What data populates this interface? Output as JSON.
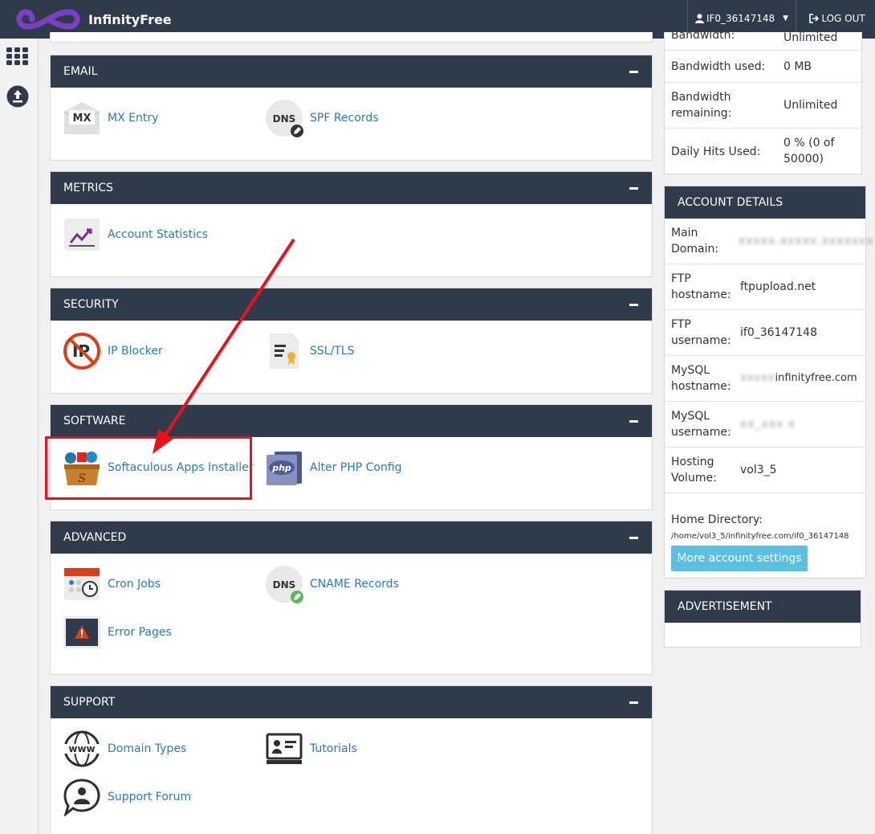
{
  "app": {
    "name": "InfinityFree"
  },
  "topbar": {
    "username": "IF0_36147148",
    "logout_label": "LOG OUT"
  },
  "panels": {
    "email": {
      "title": "EMAIL",
      "items": [
        {
          "label": "MX Entry"
        },
        {
          "label": "SPF Records"
        }
      ]
    },
    "metrics": {
      "title": "METRICS",
      "items": [
        {
          "label": "Account Statistics"
        }
      ]
    },
    "security": {
      "title": "SECURITY",
      "items": [
        {
          "label": "IP Blocker"
        },
        {
          "label": "SSL/TLS"
        }
      ]
    },
    "software": {
      "title": "SOFTWARE",
      "items": [
        {
          "label": "Softaculous Apps Installer"
        },
        {
          "label": "Alter PHP Config"
        }
      ]
    },
    "advanced": {
      "title": "ADVANCED",
      "items": [
        {
          "label": "Cron Jobs"
        },
        {
          "label": "CNAME Records"
        },
        {
          "label": "Error Pages"
        }
      ]
    },
    "support": {
      "title": "SUPPORT",
      "items": [
        {
          "label": "Domain Types"
        },
        {
          "label": "Tutorials"
        },
        {
          "label": "Support Forum"
        }
      ]
    }
  },
  "icons": {
    "mx": "MX",
    "dns": "DNS",
    "php": "php",
    "www": "www",
    "ip": "IP"
  },
  "stats": {
    "rows": [
      {
        "key": "Bandwidth:",
        "value": "Unlimited"
      },
      {
        "key": "Bandwidth used:",
        "value": "0 MB"
      },
      {
        "key": "Bandwidth remaining:",
        "value": "Unlimited"
      },
      {
        "key": "Daily Hits Used:",
        "value": "0 % (0 of 50000)"
      }
    ]
  },
  "account": {
    "title": "ACCOUNT DETAILS",
    "rows": [
      {
        "key": "Main Domain:",
        "value": "",
        "redacted": true
      },
      {
        "key": "FTP hostname:",
        "value": "ftpupload.net"
      },
      {
        "key": "FTP username:",
        "value": "if0_36147148"
      },
      {
        "key": "MySQL hostname:",
        "value": "infinityfree.com",
        "redacted": true
      },
      {
        "key": "MySQL username:",
        "value": "",
        "redacted": true
      },
      {
        "key": "Hosting Volume:",
        "value": "vol3_5"
      }
    ],
    "home_label": "Home Directory:",
    "home_path": "/home/vol3_5/infinityfree.com/if0_36147148",
    "settings_button": "More account settings"
  },
  "ad": {
    "title": "ADVERTISEMENT"
  },
  "colors": {
    "header": "#2f3b4b",
    "link": "#2a7ab8",
    "button": "#5bc0de",
    "annotation": "#e8131a"
  }
}
